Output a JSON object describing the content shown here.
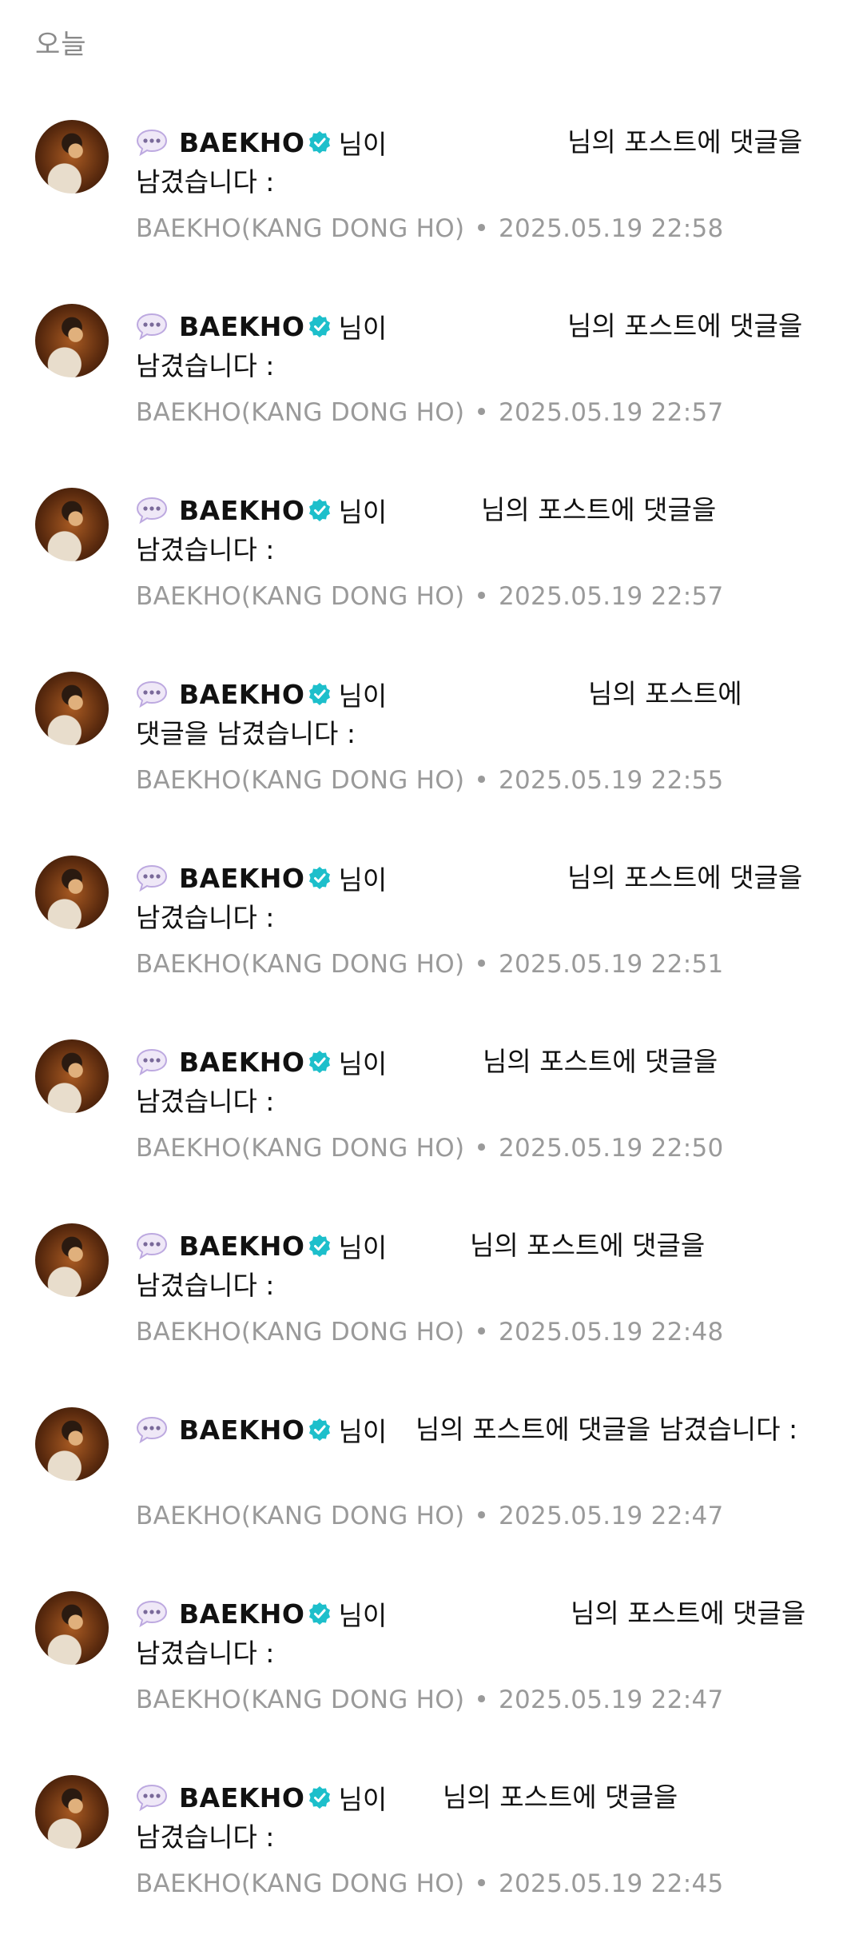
{
  "section_header": "오늘",
  "colors": {
    "verified_badge": "#1DBFCB",
    "meta_text": "#9a9a9a",
    "bubble_icon": "#c9b8e8"
  },
  "icons": {
    "comment_bubble": "speech-bubble-icon",
    "verified": "verified-badge-icon"
  },
  "notifications": [
    {
      "author": "BAEKHO",
      "suffix": "님이",
      "post_text": "님의 포스트에 댓글을",
      "continuation": "남겼습니다 :",
      "source": "BAEKHO(KANG DONG HO)",
      "separator": "•",
      "time": "2025.05.19 22:58"
    },
    {
      "author": "BAEKHO",
      "suffix": "님이",
      "post_text": "님의 포스트에 댓글을",
      "continuation": "남겼습니다 :",
      "source": "BAEKHO(KANG DONG HO)",
      "separator": "•",
      "time": "2025.05.19 22:57"
    },
    {
      "author": "BAEKHO",
      "suffix": "님이",
      "post_text": "님의 포스트에 댓글을",
      "continuation": "남겼습니다 :",
      "source": "BAEKHO(KANG DONG HO)",
      "separator": "•",
      "time": "2025.05.19 22:57"
    },
    {
      "author": "BAEKHO",
      "suffix": "님이",
      "post_text": "님의 포스트에",
      "continuation": "댓글을 남겼습니다 :",
      "source": "BAEKHO(KANG DONG HO)",
      "separator": "•",
      "time": "2025.05.19 22:55"
    },
    {
      "author": "BAEKHO",
      "suffix": "님이",
      "post_text": "님의 포스트에 댓글을",
      "continuation": "남겼습니다 :",
      "source": "BAEKHO(KANG DONG HO)",
      "separator": "•",
      "time": "2025.05.19 22:51"
    },
    {
      "author": "BAEKHO",
      "suffix": "님이",
      "post_text": "님의 포스트에 댓글을",
      "continuation": "남겼습니다 :",
      "source": "BAEKHO(KANG DONG HO)",
      "separator": "•",
      "time": "2025.05.19 22:50"
    },
    {
      "author": "BAEKHO",
      "suffix": "님이",
      "post_text": "님의 포스트에 댓글을",
      "continuation": "남겼습니다 :",
      "source": "BAEKHO(KANG DONG HO)",
      "separator": "•",
      "time": "2025.05.19 22:48"
    },
    {
      "author": "BAEKHO",
      "suffix": "님이",
      "post_text": "님의 포스트에 댓글을 남겼습니다 :",
      "continuation": "",
      "source": "BAEKHO(KANG DONG HO)",
      "separator": "•",
      "time": "2025.05.19 22:47"
    },
    {
      "author": "BAEKHO",
      "suffix": "님이",
      "post_text": "님의 포스트에 댓글을",
      "continuation": "남겼습니다 :",
      "source": "BAEKHO(KANG DONG HO)",
      "separator": "•",
      "time": "2025.05.19 22:47"
    },
    {
      "author": "BAEKHO",
      "suffix": "님이",
      "post_text": "님의 포스트에 댓글을",
      "continuation": "남겼습니다 :",
      "source": "BAEKHO(KANG DONG HO)",
      "separator": "•",
      "time": "2025.05.19 22:45"
    }
  ]
}
